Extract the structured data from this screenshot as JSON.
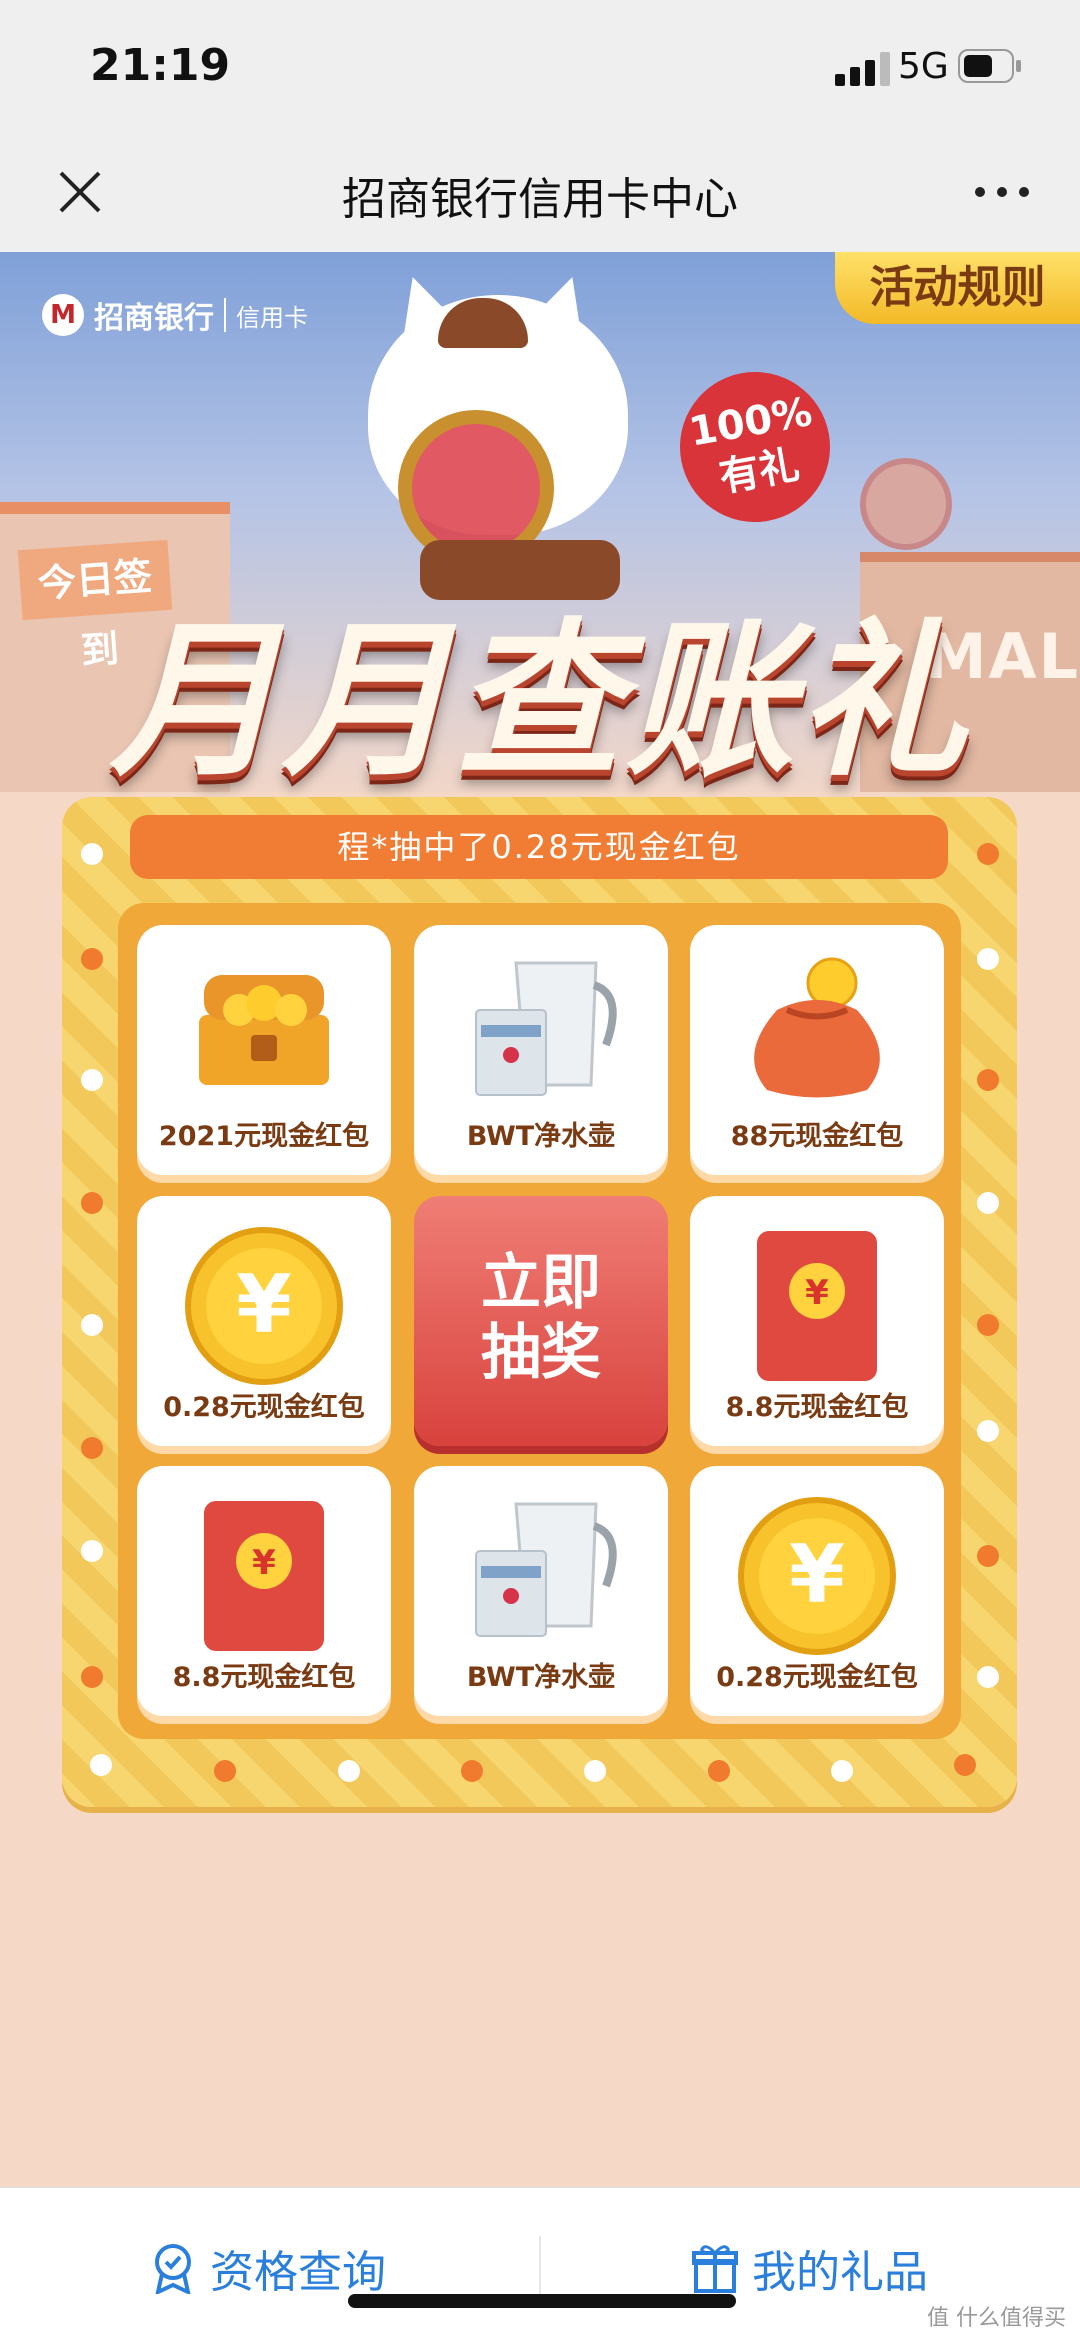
{
  "status": {
    "time": "21:19",
    "network": "5G",
    "signal_icon": "signal-icon",
    "battery_icon": "battery-icon"
  },
  "nav": {
    "title": "招商银行信用卡中心",
    "close_icon": "close-icon",
    "more_icon": "more-icon"
  },
  "banner": {
    "bank_name": "招商银行",
    "card_label": "信用卡",
    "rules_button": "活动规则",
    "badge_line1": "100%",
    "badge_line2": "有礼",
    "title": "月月查账礼",
    "store_sign_left": "今日签到",
    "store_sign_right": "MAL"
  },
  "ticker": "程*抽中了0.28元现金红包",
  "prizes": [
    {
      "label": "2021元现金红包",
      "icon": "treasure-chest-icon"
    },
    {
      "label": "BWT净水壶",
      "icon": "water-pitcher-icon"
    },
    {
      "label": "88元现金红包",
      "icon": "money-bag-icon"
    },
    {
      "label": "0.28元现金红包",
      "icon": "yuan-coin-icon"
    },
    {
      "label": "8.8元现金红包",
      "icon": "red-envelope-icon"
    },
    {
      "label": "8.8元现金红包",
      "icon": "red-envelope-icon"
    },
    {
      "label": "BWT净水壶",
      "icon": "water-pitcher-icon"
    },
    {
      "label": "0.28元现金红包",
      "icon": "yuan-coin-icon"
    }
  ],
  "draw_button": {
    "line1": "立即",
    "line2": "抽奖"
  },
  "bottom_tabs": [
    {
      "label": "资格查询",
      "icon": "badge-icon"
    },
    {
      "label": "我的礼品",
      "icon": "gift-icon"
    }
  ],
  "watermark": "值 什么值得买",
  "colors": {
    "accent": "#2a7fdc",
    "board": "#f3c85a",
    "draw": "#d9423d",
    "ticker": "#f07d33"
  }
}
